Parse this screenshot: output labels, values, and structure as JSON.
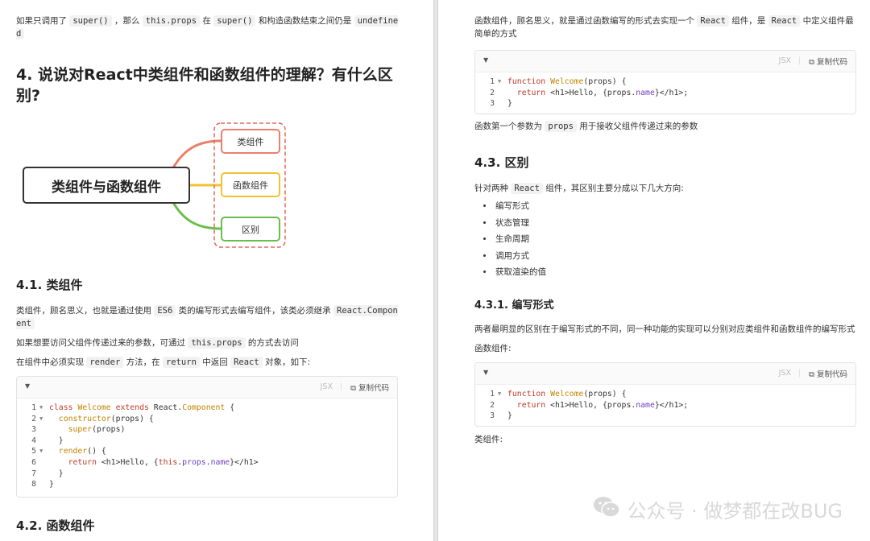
{
  "left": {
    "intro": {
      "pre": "如果只调用了",
      "c1": "super()",
      "mid1": "，那么",
      "c2": "this.props",
      "mid2": "在",
      "c3": "super()",
      "mid3": "和构造函数结束之间仍是",
      "c4": "undefined"
    },
    "h2": "4. 说说对React中类组件和函数组件的理解？有什么区别?",
    "mindmap": {
      "center": "类组件与函数组件",
      "nodes": [
        "类组件",
        "函数组件",
        "区别"
      ],
      "colors": {
        "n1": "#e8806b",
        "n2": "#f1c232",
        "n3": "#6abf4b",
        "frame": "#e06c5a"
      }
    },
    "s41": {
      "title": "4.1. 类组件",
      "p1": {
        "pre": "类组件，顾名思义，也就是通过使用",
        "c1": "ES6",
        "mid": "类的编写形式去编写组件，该类必须继承",
        "c2": "React.Component"
      },
      "p2": {
        "pre": "如果想要访问父组件传递过来的参数，可通过",
        "c1": "this.props",
        "post": "的方式去访问"
      },
      "p3": {
        "pre": "在组件中必须实现",
        "c1": "render",
        "mid1": "方法，在",
        "c2": "return",
        "mid2": "中返回",
        "c3": "React",
        "post": "对象，如下:"
      }
    },
    "code1": {
      "lang": "JSX",
      "copy": "复制代码"
    },
    "s42": "4.2. 函数组件"
  },
  "right": {
    "p1": {
      "pre": "函数组件，顾名思义，就是通过函数编写的形式去实现一个",
      "c1": "React",
      "mid": "组件，是",
      "c2": "React",
      "post": "中定义组件最简单的方式"
    },
    "code2": {
      "lang": "JSX",
      "copy": "复制代码"
    },
    "p2": {
      "pre": "函数第一个参数为",
      "c1": "props",
      "post": "用于接收父组件传递过来的参数"
    },
    "s43": "4.3. 区别",
    "p3": {
      "pre": "针对两种",
      "c1": "React",
      "post": "组件，其区别主要分成以下几大方向:"
    },
    "bullets": [
      "编写形式",
      "状态管理",
      "生命周期",
      "调用方式",
      "获取渲染的值"
    ],
    "s431": "4.3.1. 编写形式",
    "p4": "两者最明显的区别在于编写形式的不同，同一种功能的实现可以分别对应类组件和函数组件的编写形式",
    "p5": "函数组件:",
    "code3": {
      "lang": "JSX",
      "copy": "复制代码"
    },
    "p6": "类组件:"
  },
  "watermark": "公众号 · 做梦都在改BUG"
}
